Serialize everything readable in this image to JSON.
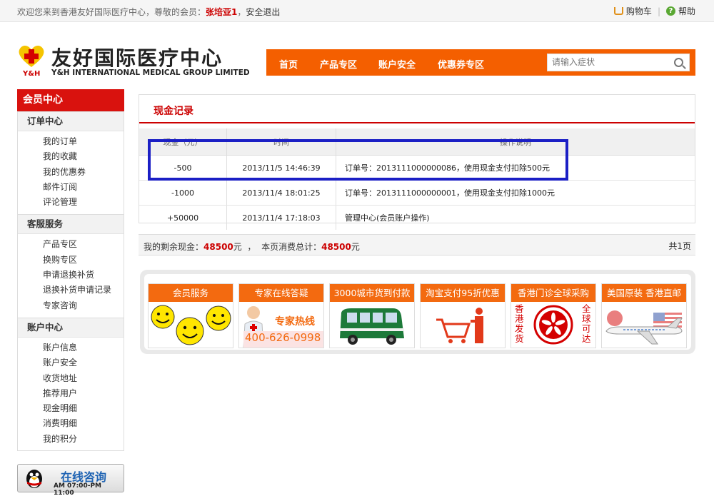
{
  "topbar": {
    "welcome": "欢迎您来到香港友好国际医疗中心，尊敬的会员：",
    "username": "张培亚1",
    "comma": "，",
    "logout": "安全退出",
    "cart": "购物车",
    "help": "帮助",
    "separator": "|"
  },
  "logo": {
    "cn": "友好国际医疗中心",
    "en": "Y&H INTERNATIONAL MEDICAL GROUP LIMITED",
    "mark": "Y&H"
  },
  "nav": {
    "items": [
      "首页",
      "产品专区",
      "账户安全",
      "优惠券专区"
    ],
    "search_placeholder": "请输入症状"
  },
  "sidebar": {
    "title": "会员中心",
    "groups": [
      {
        "title": "订单中心",
        "items": [
          "我的订单",
          "我的收藏",
          "我的优惠券",
          "邮件订阅",
          "评论管理"
        ]
      },
      {
        "title": "客服服务",
        "items": [
          "产品专区",
          "换购专区",
          "申请退换补货",
          "退换补货申请记录",
          "专家咨询"
        ]
      },
      {
        "title": "账户中心",
        "items": [
          "账户信息",
          "账户安全",
          "收货地址",
          "推荐用户",
          "现金明细",
          "消费明细",
          "我的积分"
        ]
      }
    ]
  },
  "qq": {
    "label": "在线咨询",
    "hours": "AM 07:00-PM 11:00"
  },
  "records": {
    "title": "现金记录",
    "headers": [
      "现金（元）",
      "时间",
      "操作说明"
    ],
    "rows": [
      {
        "amount": "-500",
        "time": "2013/11/5 14:46:39",
        "note": "订单号：2013111000000086，使用现金支付扣除500元"
      },
      {
        "amount": "-1000",
        "time": "2013/11/4 18:01:25",
        "note": "订单号：2013111000000001，使用现金支付扣除1000元"
      },
      {
        "amount": "+50000",
        "time": "2013/11/4 17:18:03",
        "note": "管理中心(会员账户操作)"
      }
    ]
  },
  "summary": {
    "balance_label": "我的剩余现金：",
    "balance": "48500",
    "unit": "元",
    "sep": "，",
    "total_label": "本页消费总计：",
    "total": "48500",
    "pages": "共1页"
  },
  "banner": {
    "cards": [
      "会员服务",
      "专家在线答疑",
      "3000城市货到付款",
      "淘宝支付95折优惠",
      "香港门诊全球采购",
      "美国原装 香港直邮"
    ],
    "hotline_label": "专家热线",
    "hotline": "400-626-0998",
    "hk_left": "香港发货",
    "hk_right": "全球可达"
  }
}
